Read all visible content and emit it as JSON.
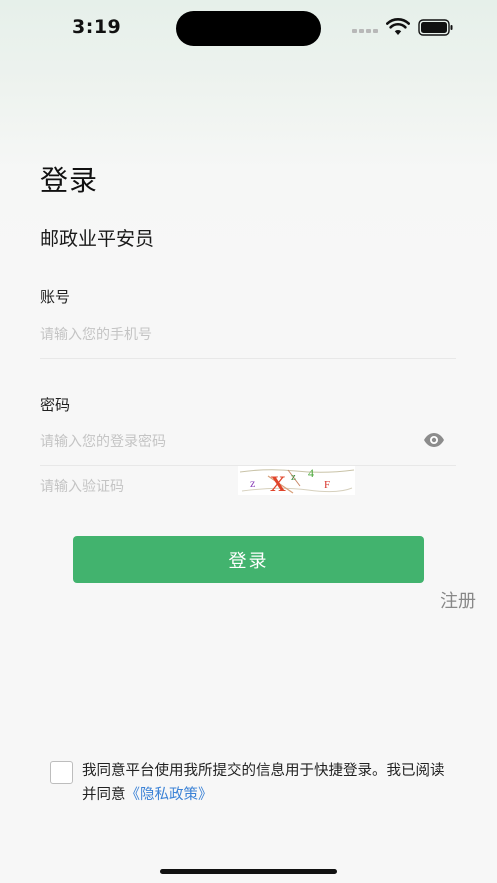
{
  "status_bar": {
    "time": "3:19"
  },
  "header": {
    "title": "登录",
    "subtitle": "邮政业平安员"
  },
  "form": {
    "account": {
      "label": "账号",
      "placeholder": "请输入您的手机号",
      "value": ""
    },
    "password": {
      "label": "密码",
      "placeholder": "请输入您的登录密码",
      "value": ""
    },
    "captcha": {
      "placeholder": "请输入验证码",
      "value": "",
      "image_chars": [
        "z",
        "X",
        "z",
        "4",
        "F"
      ],
      "image_char_colors": [
        "#8a3fb8",
        "#e0442a",
        "#3f8f3f",
        "#4aa83a",
        "#d8332a"
      ]
    },
    "login_button": "登录",
    "register_link": "注册"
  },
  "agreement": {
    "checked": false,
    "text": "我同意平台使用我所提交的信息用于快捷登录。我已阅读并同意",
    "privacy_link": "《隐私政策》"
  },
  "colors": {
    "primary": "#42b36e",
    "link": "#3b82d6"
  },
  "icons": {
    "password_toggle": "eye-icon",
    "wifi": "wifi-icon",
    "battery": "battery-icon",
    "cellular": "cellular-signal-icon"
  }
}
